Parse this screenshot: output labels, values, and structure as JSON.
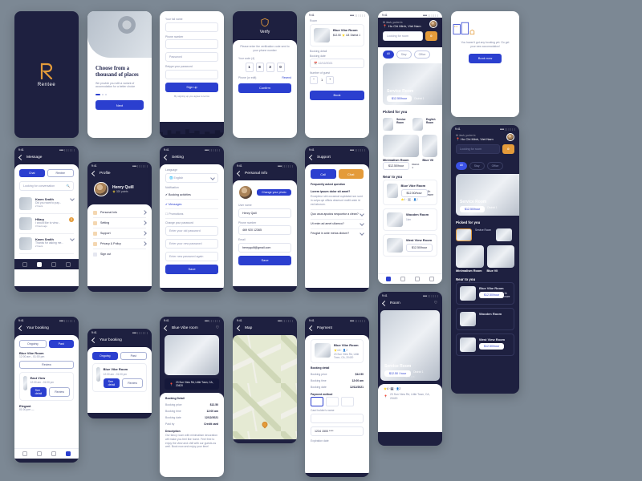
{
  "brand": {
    "name": "Rentee"
  },
  "time": "9:41",
  "onboard": {
    "headline": "Choose from a thousand of places",
    "sub": "We provide you with a variant of accomodation for a better choice",
    "cta": "Next"
  },
  "signup": {
    "full_name_ph": "Your full name",
    "phone_label": "Phone number",
    "password_ph": "Password",
    "repass_label": "Retype your password",
    "submit": "Sign up",
    "legal": "By signing up you agree to terms"
  },
  "verify": {
    "title": "Verify",
    "instr": "Please enter the verification code sent to your phone number",
    "your_code": "Your code (4)",
    "digits": [
      "1",
      "8",
      "3",
      "0"
    ],
    "phone_label": "Phone (or edit)",
    "resend": "Resend",
    "confirm": "Confirm"
  },
  "book_form": {
    "room": "Room",
    "room_name": "Blue Vibe Room",
    "price": "$12.50",
    "rating": "⭐ 4.8",
    "district": "District 1",
    "checkin_label": "Booking detail",
    "date_label": "Booking date",
    "date": "12/12/2021",
    "guests_label": "Number of guest",
    "book": "Book"
  },
  "home": {
    "greeting": "Hi Josh, you're in",
    "location": "Ho Chi Minh, Viet Nam",
    "search_ph": "Looking for room",
    "chips": [
      "All",
      "Stay",
      "Office"
    ],
    "hero_name": "Service Room",
    "hero_price": "$12.50/hour",
    "hero_area": "District 1",
    "picked_title": "Picked for you",
    "picked": [
      {
        "name": "Service Room"
      },
      {
        "name": "English Room"
      }
    ],
    "listA_name": "Minimalism Room",
    "listA_price": "$12.50/hour",
    "listA_dist": "District 1",
    "listB_name": "Blue Vil",
    "near_title": "Near to you",
    "near": [
      {
        "name": "Blue Vibe Room",
        "price": "$12.50/hour",
        "more": "1h more"
      },
      {
        "name": "Wooden Room",
        "more": "1km"
      },
      {
        "name": "West View Room",
        "price": "$12.50/hour"
      }
    ]
  },
  "empty": {
    "msg": "You haven't got any booking yet. Go get your new accomodation!",
    "cta": "Book now"
  },
  "messages": {
    "title": "Message",
    "tabs": [
      "Chat",
      "Rentee"
    ],
    "search": "Looking for conversation",
    "items": [
      {
        "name": "Kwen Smith",
        "msg": "Did you want to pay...",
        "time": "2 hours"
      },
      {
        "name": "Hilary",
        "msg": "I would like to view...",
        "time": "3 hours ago",
        "unread": "3"
      },
      {
        "name": "Kwen Smith",
        "msg": "Thanks for asking me...",
        "time": "2 hours"
      }
    ]
  },
  "profile": {
    "title": "Profile",
    "name": "Henry Quill",
    "points": "320 points",
    "links": [
      "Personal Info",
      "Setting",
      "Support",
      "Privacy & Policy",
      "Sign out"
    ]
  },
  "settings": {
    "title": "Setting",
    "lang_label": "Language",
    "lang": "English",
    "notif_title": "Notification",
    "notifs": [
      {
        "label": "Booking activities",
        "on": true
      },
      {
        "label": "Messages",
        "on": true
      },
      {
        "label": "Promotions",
        "on": false
      }
    ],
    "pw_title": "Change your password",
    "pw_old": "Enter your old password",
    "pw_new": "Enter your new password",
    "pw_again": "Enter new password again",
    "save": "Save"
  },
  "personal": {
    "title": "Personal Info",
    "change_photo": "Change your photo",
    "username_label": "User name",
    "username": "Henry Quill",
    "phone_label": "Phone number",
    "phone": "469 920 12365",
    "email_label": "Email",
    "email": "henryquill@gmail.com",
    "save": "Save"
  },
  "support": {
    "title": "Support",
    "call": "Call",
    "chat": "Chat",
    "faq_title": "Frequently asked question",
    "faq_open": "Lorem ipsum dolor sit amet?",
    "faq_body": "Excepteur sint occaecat cupidatat non sunt in culpa qui officia deserunt mollit anim id est laborum.",
    "faqs": [
      "Quo usus apudus sequuntur a clean?",
      "Ut enim ad amet ullamco?",
      "Feugiat in ante metus dictum?"
    ]
  },
  "bookings": {
    "title": "Your booking",
    "tabs": [
      "Ongoing",
      "Past"
    ],
    "items": [
      {
        "name": "Blue Vibe Room",
        "time": "12:00 am - 01:00 pm",
        "a": "Review"
      },
      {
        "name": "East View",
        "time": "12:00 am - 01:00 pm",
        "a": "See detail",
        "b": "Review"
      },
      {
        "name": "Elegant",
        "time": "01:00 pm —"
      }
    ]
  },
  "booking2": {
    "title": "Your booking",
    "tabs": [
      "Ongoing",
      "Past"
    ],
    "item": {
      "name": "Blue Vibe Room",
      "time": "12:00 am - 01:00 pm",
      "a": "See detail",
      "b": "Review"
    }
  },
  "detail": {
    "title": "Blue Vibe room",
    "address": "23 Sun View Rd, Little Town, CA, 20420",
    "section": "Booking Detail",
    "rows": [
      [
        "Booking price",
        "$12.50"
      ],
      [
        "Booking time",
        "12:00 am"
      ],
      [
        "Booking date",
        "12/12/2021"
      ],
      [
        "Paid by",
        "Credit card"
      ]
    ],
    "desc_label": "Description",
    "desc": "Our fancy room with minimalism decoration will make you feel like home. Feel free to enjoy the view and chill with our guests as well. Book now and enjoy your time!"
  },
  "map": {
    "title": "Map"
  },
  "payment": {
    "title": "Payment",
    "room": "Blue Vibe Room",
    "address": "23 Sun View Rd, Little Town, CA, 20420",
    "section": "Booking detail",
    "rows": [
      [
        "Booking price",
        "$12.50"
      ],
      [
        "Booking time",
        "12:00 am"
      ],
      [
        "Booking date",
        "12/12/2021"
      ]
    ],
    "pm_label": "Payment method",
    "card_label": "Card holder's name",
    "card_num": "1234 1500 ****",
    "exp_label": "Expiration date"
  },
  "room_detail": {
    "title": "Room",
    "name": "Service Room",
    "price": "$12.50 / hour",
    "district": "District 1",
    "address": "23 Sun View Rd, Little Town, CA, 20420"
  }
}
